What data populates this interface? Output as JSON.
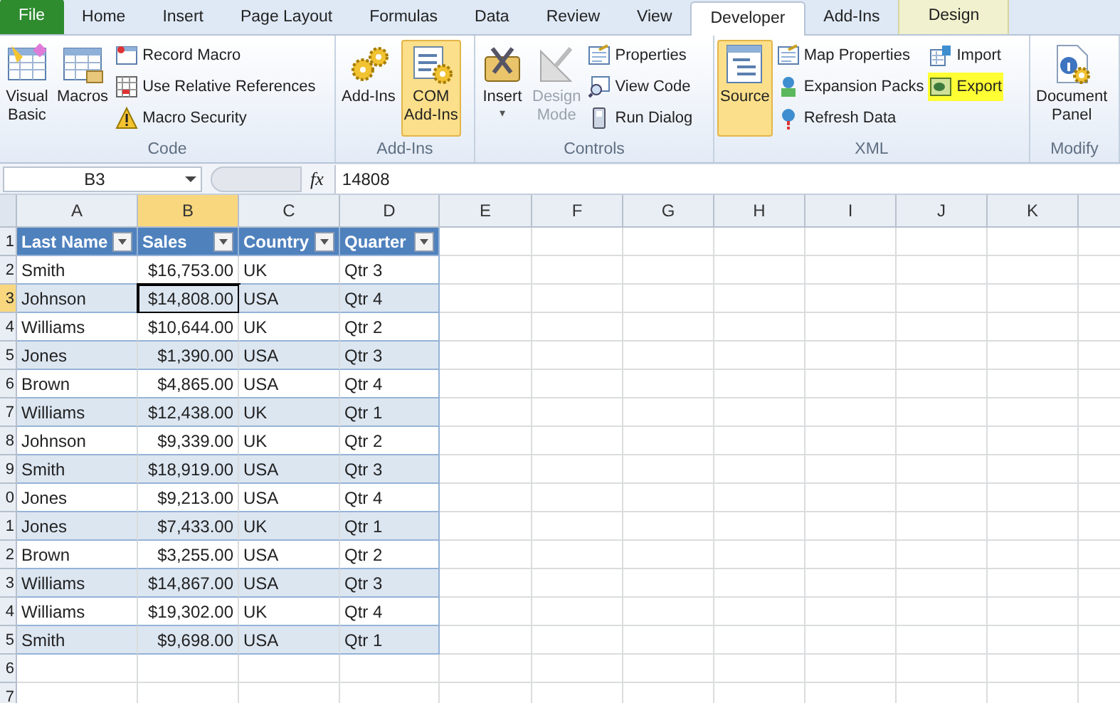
{
  "tabs": [
    {
      "label": "File",
      "kind": "file",
      "selected": false
    },
    {
      "label": "Home",
      "kind": "tab",
      "selected": false
    },
    {
      "label": "Insert",
      "kind": "tab",
      "selected": false
    },
    {
      "label": "Page Layout",
      "kind": "tab",
      "selected": false
    },
    {
      "label": "Formulas",
      "kind": "tab",
      "selected": false
    },
    {
      "label": "Data",
      "kind": "tab",
      "selected": false
    },
    {
      "label": "Review",
      "kind": "tab",
      "selected": false
    },
    {
      "label": "View",
      "kind": "tab",
      "selected": false
    },
    {
      "label": "Developer",
      "kind": "tab",
      "selected": true
    },
    {
      "label": "Add-Ins",
      "kind": "tab",
      "selected": false
    },
    {
      "label": "Design",
      "kind": "context",
      "selected": false
    }
  ],
  "ribbon_groups": [
    {
      "label": "Code",
      "large": [
        {
          "lines": [
            "Visual",
            "Basic"
          ],
          "selected": false,
          "disabled": false
        },
        {
          "lines": [
            "Macros"
          ],
          "selected": false,
          "disabled": false
        }
      ],
      "small": [
        [
          {
            "label": "Record Macro",
            "highlighted": false
          },
          {
            "label": "Use Relative References",
            "highlighted": false
          },
          {
            "label": "Macro Security",
            "highlighted": false
          }
        ]
      ]
    },
    {
      "label": "Add-Ins",
      "large": [
        {
          "lines": [
            "Add-Ins"
          ],
          "selected": false,
          "disabled": false
        },
        {
          "lines": [
            "COM",
            "Add-Ins"
          ],
          "selected": true,
          "disabled": false
        }
      ]
    },
    {
      "label": "Controls",
      "large": [
        {
          "lines": [
            "Insert"
          ],
          "selected": false,
          "disabled": false,
          "dropdown": "▾"
        },
        {
          "lines": [
            "Design",
            "Mode"
          ],
          "selected": false,
          "disabled": true
        }
      ],
      "small": [
        [
          {
            "label": "Properties",
            "highlighted": false
          },
          {
            "label": "View Code",
            "highlighted": false
          },
          {
            "label": "Run Dialog",
            "highlighted": false
          }
        ]
      ]
    },
    {
      "label": "XML",
      "large": [
        {
          "lines": [
            "Source"
          ],
          "selected": true,
          "disabled": false
        }
      ],
      "small": [
        [
          {
            "label": "Map Properties",
            "highlighted": false
          },
          {
            "label": "Expansion Packs",
            "highlighted": false
          },
          {
            "label": "Refresh Data",
            "highlighted": false
          }
        ],
        [
          {
            "label": "Import",
            "highlighted": false
          },
          {
            "label": "Export",
            "highlighted": true
          }
        ]
      ]
    },
    {
      "label": "Modify",
      "large": [
        {
          "lines": [
            "Document",
            "Panel"
          ],
          "selected": false,
          "disabled": false
        }
      ]
    }
  ],
  "formula_bar": {
    "name_box": "B3",
    "fx": "fx",
    "value": "14808"
  },
  "sheet": {
    "columns": [
      {
        "label": "A",
        "selected": false
      },
      {
        "label": "B",
        "selected": true
      },
      {
        "label": "C",
        "selected": false
      },
      {
        "label": "D",
        "selected": false
      },
      {
        "label": "E",
        "selected": false
      },
      {
        "label": "F",
        "selected": false
      },
      {
        "label": "G",
        "selected": false
      },
      {
        "label": "H",
        "selected": false
      },
      {
        "label": "I",
        "selected": false
      },
      {
        "label": "J",
        "selected": false
      },
      {
        "label": "K",
        "selected": false
      }
    ],
    "row_numbers": [
      {
        "label": "1",
        "selected": false
      },
      {
        "label": "2",
        "selected": false
      },
      {
        "label": "3",
        "selected": true
      },
      {
        "label": "4",
        "selected": false
      },
      {
        "label": "5",
        "selected": false
      },
      {
        "label": "6",
        "selected": false
      },
      {
        "label": "7",
        "selected": false
      },
      {
        "label": "8",
        "selected": false
      },
      {
        "label": "9",
        "selected": false
      },
      {
        "label": "0",
        "selected": false
      },
      {
        "label": "1",
        "selected": false
      },
      {
        "label": "2",
        "selected": false
      },
      {
        "label": "3",
        "selected": false
      },
      {
        "label": "4",
        "selected": false
      },
      {
        "label": "5",
        "selected": false
      },
      {
        "label": "6",
        "selected": false
      },
      {
        "label": "7",
        "selected": false
      }
    ],
    "table_headers": [
      "Last Name",
      "Sales",
      "Country",
      "Quarter"
    ],
    "rows": [
      [
        {
          "text": "Smith",
          "selected": false
        },
        {
          "text": "$16,753.00",
          "selected": false
        },
        {
          "text": "UK",
          "selected": false
        },
        {
          "text": "Qtr 3",
          "selected": false
        }
      ],
      [
        {
          "text": "Johnson",
          "selected": false
        },
        {
          "text": "$14,808.00",
          "selected": true
        },
        {
          "text": "USA",
          "selected": false
        },
        {
          "text": "Qtr 4",
          "selected": false
        }
      ],
      [
        {
          "text": "Williams",
          "selected": false
        },
        {
          "text": "$10,644.00",
          "selected": false
        },
        {
          "text": "UK",
          "selected": false
        },
        {
          "text": "Qtr 2",
          "selected": false
        }
      ],
      [
        {
          "text": "Jones",
          "selected": false
        },
        {
          "text": "$1,390.00",
          "selected": false
        },
        {
          "text": "USA",
          "selected": false
        },
        {
          "text": "Qtr 3",
          "selected": false
        }
      ],
      [
        {
          "text": "Brown",
          "selected": false
        },
        {
          "text": "$4,865.00",
          "selected": false
        },
        {
          "text": "USA",
          "selected": false
        },
        {
          "text": "Qtr 4",
          "selected": false
        }
      ],
      [
        {
          "text": "Williams",
          "selected": false
        },
        {
          "text": "$12,438.00",
          "selected": false
        },
        {
          "text": "UK",
          "selected": false
        },
        {
          "text": "Qtr 1",
          "selected": false
        }
      ],
      [
        {
          "text": "Johnson",
          "selected": false
        },
        {
          "text": "$9,339.00",
          "selected": false
        },
        {
          "text": "UK",
          "selected": false
        },
        {
          "text": "Qtr 2",
          "selected": false
        }
      ],
      [
        {
          "text": "Smith",
          "selected": false
        },
        {
          "text": "$18,919.00",
          "selected": false
        },
        {
          "text": "USA",
          "selected": false
        },
        {
          "text": "Qtr 3",
          "selected": false
        }
      ],
      [
        {
          "text": "Jones",
          "selected": false
        },
        {
          "text": "$9,213.00",
          "selected": false
        },
        {
          "text": "USA",
          "selected": false
        },
        {
          "text": "Qtr 4",
          "selected": false
        }
      ],
      [
        {
          "text": "Jones",
          "selected": false
        },
        {
          "text": "$7,433.00",
          "selected": false
        },
        {
          "text": "UK",
          "selected": false
        },
        {
          "text": "Qtr 1",
          "selected": false
        }
      ],
      [
        {
          "text": "Brown",
          "selected": false
        },
        {
          "text": "$3,255.00",
          "selected": false
        },
        {
          "text": "USA",
          "selected": false
        },
        {
          "text": "Qtr 2",
          "selected": false
        }
      ],
      [
        {
          "text": "Williams",
          "selected": false
        },
        {
          "text": "$14,867.00",
          "selected": false
        },
        {
          "text": "USA",
          "selected": false
        },
        {
          "text": "Qtr 3",
          "selected": false
        }
      ],
      [
        {
          "text": "Williams",
          "selected": false
        },
        {
          "text": "$19,302.00",
          "selected": false
        },
        {
          "text": "UK",
          "selected": false
        },
        {
          "text": "Qtr 4",
          "selected": false
        }
      ],
      [
        {
          "text": "Smith",
          "selected": false
        },
        {
          "text": "$9,698.00",
          "selected": false
        },
        {
          "text": "USA",
          "selected": false
        },
        {
          "text": "Qtr 1",
          "selected": false
        }
      ]
    ]
  }
}
